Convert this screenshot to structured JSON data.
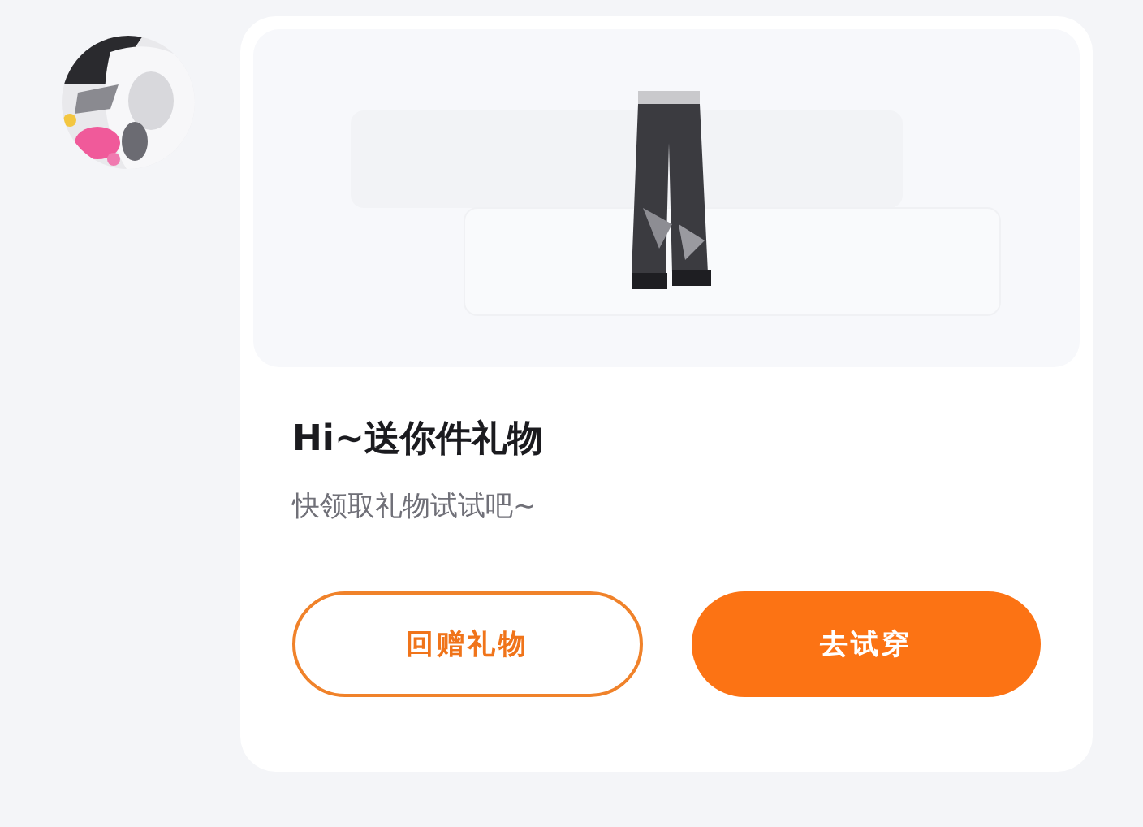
{
  "card": {
    "title": "Hi~送你件礼物",
    "subtitle": "快领取礼物试试吧~",
    "buttons": [
      {
        "label": "回赠礼物",
        "kind": "outline"
      },
      {
        "label": "去试穿",
        "kind": "filled"
      }
    ]
  }
}
